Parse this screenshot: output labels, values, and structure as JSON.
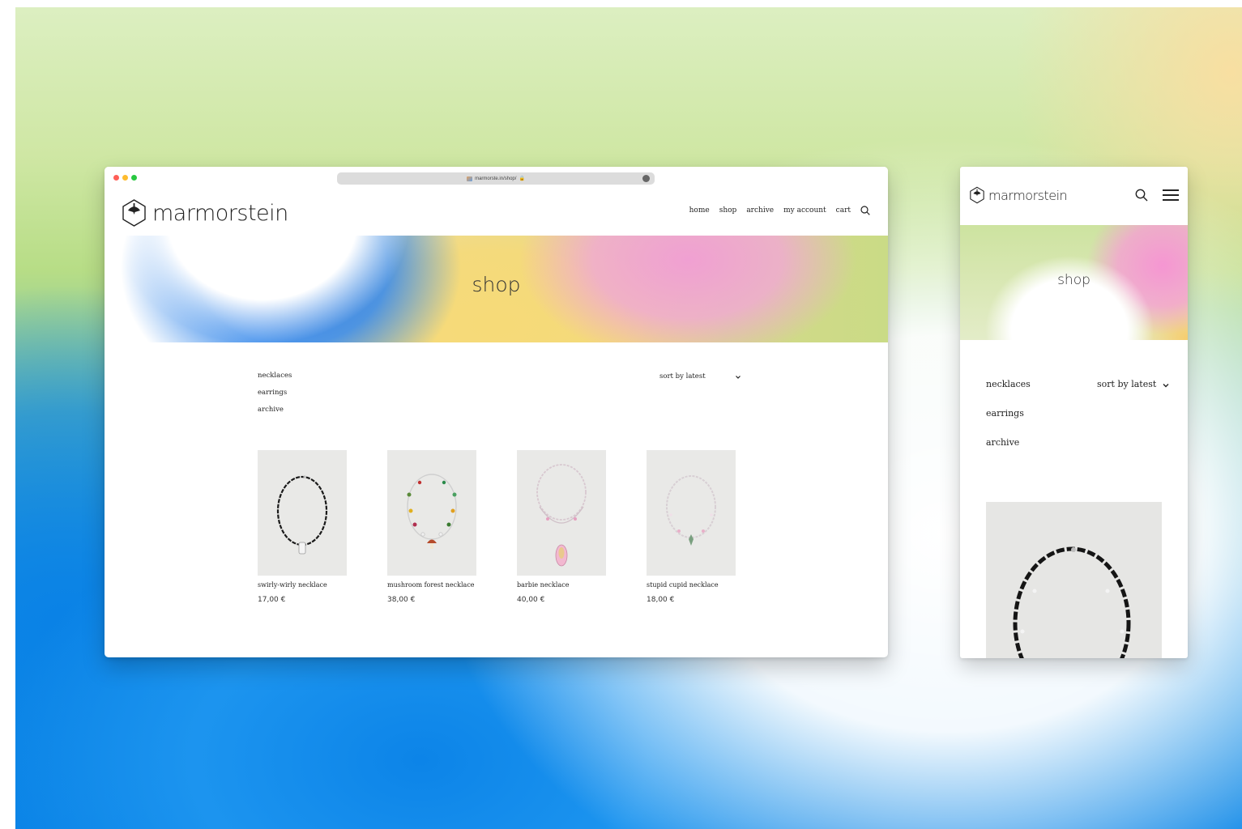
{
  "desktop": {
    "url": "marmorste.in/shop/",
    "logo_text": "marmorstein",
    "nav": [
      "home",
      "shop",
      "archive",
      "my account",
      "cart"
    ],
    "hero_title": "shop",
    "categories": [
      "necklaces",
      "earrings",
      "archive"
    ],
    "sort_label": "sort by latest",
    "products": [
      {
        "name": "swirly-wirly necklace",
        "price": "17,00 €"
      },
      {
        "name": "mushroom forest necklace",
        "price": "38,00 €"
      },
      {
        "name": "barbie necklace",
        "price": "40,00 €"
      },
      {
        "name": "stupid cupid necklace",
        "price": "18,00 €"
      }
    ]
  },
  "mobile": {
    "logo_text": "marmorstein",
    "hero_title": "shop",
    "categories": [
      "necklaces",
      "earrings",
      "archive"
    ],
    "sort_label": "sort by latest"
  },
  "icons": {
    "search": "search-icon",
    "menu": "hamburger-menu-icon",
    "chevron": "chevron-down-icon",
    "logo": "hexagon-logo-icon"
  },
  "colors": {
    "window_close": "#ff5f57",
    "window_minimize": "#febc2e",
    "window_zoom": "#28c840",
    "text": "#222222"
  }
}
